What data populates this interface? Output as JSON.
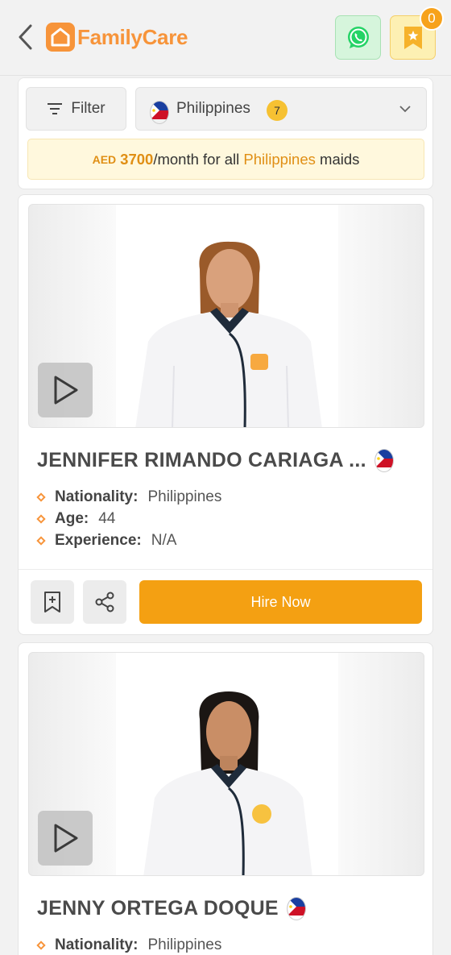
{
  "header": {
    "brand": "FamilyCare",
    "favorites_count": "0"
  },
  "filter": {
    "filter_label": "Filter",
    "country": "Philippines",
    "country_count": "7"
  },
  "price_banner": {
    "currency": "AED",
    "amount": "3700",
    "prefix": "/month for all ",
    "country": "Philippines",
    "suffix": " maids"
  },
  "labels": {
    "nationality": "Nationality:",
    "age": "Age:",
    "experience": "Experience:",
    "hire": "Hire Now"
  },
  "maids": [
    {
      "name": "JENNIFER RIMANDO CARIAGA ...",
      "nationality": "Philippines",
      "age": "44",
      "experience": "N/A"
    },
    {
      "name": "JENNY ORTEGA DOQUE",
      "nationality": "Philippines"
    }
  ],
  "colors": {
    "brand": "#f7943a",
    "accent": "#f4a012",
    "whatsapp": "#25d366"
  },
  "icons": [
    "back-arrow-icon",
    "home-logo-icon",
    "whatsapp-icon",
    "bookmark-star-icon",
    "filter-icon",
    "philippines-flag-icon",
    "chevron-down-icon",
    "play-icon",
    "bookmark-add-icon",
    "share-icon"
  ]
}
